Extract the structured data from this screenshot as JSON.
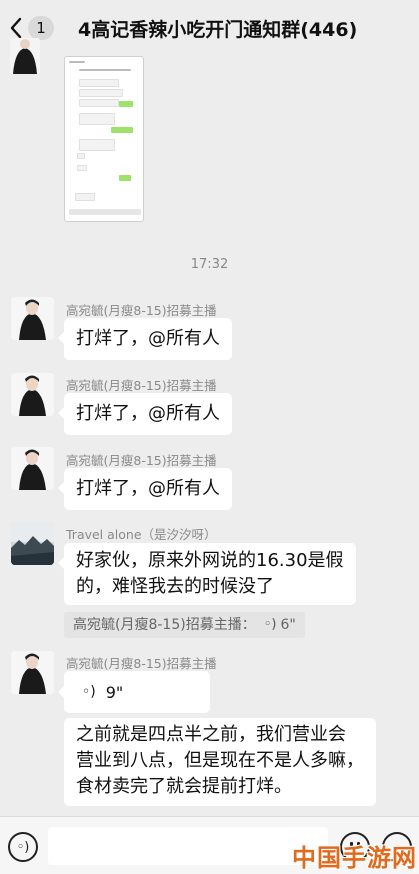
{
  "header": {
    "back_label": "<",
    "unread_count": "1",
    "title": "4高记香辣小吃开门通知群(446)"
  },
  "timestamp": "17:32",
  "messages": [
    {
      "sender": "高宛毓(月瘦8-15)招募主播",
      "text": "打烊了，@所有人"
    },
    {
      "sender": "高宛毓(月瘦8-15)招募主播",
      "text": "打烊了，@所有人"
    },
    {
      "sender": "高宛毓(月瘦8-15)招募主播",
      "text": "打烊了，@所有人"
    },
    {
      "sender": "Travel alone（是汐汐呀）",
      "lines": [
        "好家伙，原来外网说的16.30是假",
        "的，难怪我去的时候没了"
      ],
      "quote": {
        "sender": "高宛毓(月瘦8-15)招募主播：",
        "duration": "6\""
      }
    },
    {
      "sender": "高宛毓(月瘦8-15)招募主播",
      "voice_duration": "9\"",
      "lines": [
        "之前就是四点半之前，我们营业会",
        "营业到八点，但是现在不是人多嘛，",
        "食材卖完了就会提前打烊。"
      ]
    }
  ],
  "icons": {
    "voice": "voice-input-icon",
    "emoji": "emoji-icon",
    "plus": "plus-icon",
    "back": "chevron-left-icon"
  },
  "colors": {
    "background": "#ededed",
    "bubble": "#ffffff",
    "sent_bubble": "#95ec69",
    "watermark": "#e06a1d"
  },
  "watermark": "中国手游网"
}
